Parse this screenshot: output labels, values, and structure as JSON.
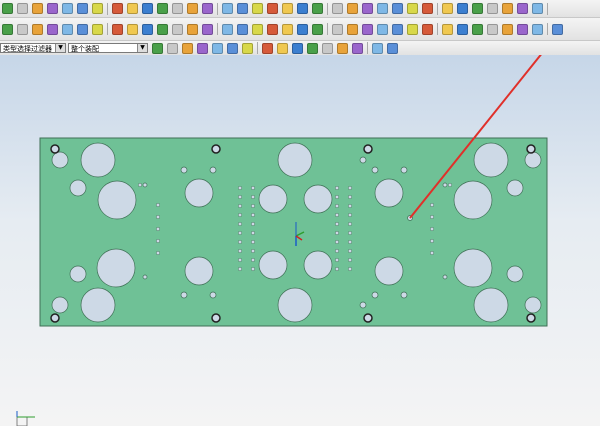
{
  "toolbar": {
    "filter_select": {
      "value": "类型选择过滤器"
    },
    "assembly_select": {
      "value": "整个装配"
    }
  },
  "colors": {
    "plate_fill": "#6fc196",
    "plate_stroke": "#3f6f55",
    "hole_fill": "#cdd9e6",
    "annotation_arrow": "#e0302a"
  },
  "icons": {
    "row1": [
      "new-icon",
      "open-icon",
      "save-icon",
      "print-icon",
      "cut-icon",
      "copy-icon",
      "paste-icon",
      "undo-icon",
      "redo-icon",
      "sketch-icon",
      "extrude-icon",
      "revolve-icon",
      "hole-icon",
      "boss-icon",
      "pocket-icon",
      "pad-icon",
      "slot-icon",
      "groove-icon",
      "edge-blend-icon",
      "chamfer-icon",
      "shell-icon",
      "draft-icon",
      "trim-body-icon",
      "split-body-icon",
      "sew-icon",
      "patch-icon",
      "offset-face-icon",
      "scale-icon",
      "mirror-icon",
      "pattern-icon",
      "unite-icon",
      "subtract-icon",
      "intersect-icon",
      "promote-icon",
      "wrap-icon"
    ],
    "row2": [
      "line-icon",
      "arc-icon",
      "circle-icon",
      "rectangle-icon",
      "polygon-icon",
      "spline-icon",
      "point-icon",
      "plane-icon",
      "axis-icon",
      "csys-icon",
      "extrude-icon",
      "revolve-icon",
      "sweep-icon",
      "tube-icon",
      "blend-icon",
      "face-blend-icon",
      "chamfer-icon",
      "trim-icon",
      "extend-icon",
      "offset-icon",
      "thicken-icon",
      "measure-icon",
      "analysis-icon",
      "section-icon",
      "layer-icon",
      "select-icon",
      "show-icon",
      "hide-icon",
      "fit-icon",
      "zoom-icon",
      "rotate-icon",
      "shaded-icon",
      "wireframe-icon",
      "edit-object-display-icon",
      "view-orient-icon",
      "camera-icon"
    ],
    "row3": [
      "select-all-icon",
      "deselect-icon",
      "feature-select-icon",
      "body-select-icon",
      "face-select-icon",
      "edge-select-icon",
      "point-select-icon",
      "end-point-icon",
      "mid-point-icon",
      "control-point-icon",
      "intersection-icon",
      "center-icon",
      "quadrant-icon",
      "tangent-icon",
      "existing-point-icon",
      "snap-icon"
    ]
  }
}
